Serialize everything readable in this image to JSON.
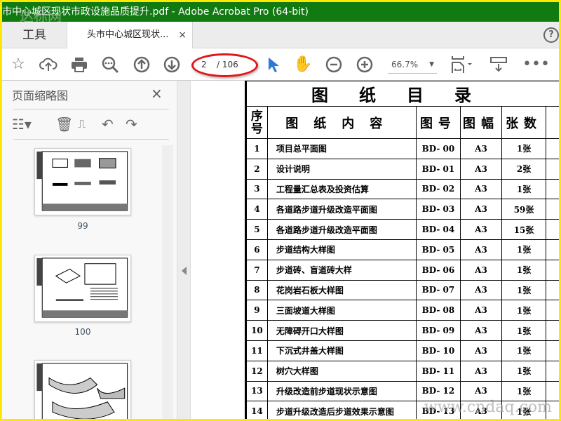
{
  "window": {
    "title": "市中心城区现状市政设施品质提升.pdf - Adobe Acrobat Pro (64-bit)",
    "watermark": "达标网"
  },
  "tabs": {
    "tools": "工具",
    "document": "头市中心城区现状...",
    "close": "×",
    "help": "?"
  },
  "toolbar": {
    "current_page": "2",
    "total_pages": "/ 106",
    "zoom": "66.7%",
    "icons": [
      "star-icon",
      "cloud-upload-icon",
      "print-icon",
      "search-zoom-icon",
      "page-up-icon",
      "page-down-icon",
      "select-arrow-icon",
      "hand-icon",
      "zoom-out-icon",
      "zoom-in-icon",
      "fit-page-icon",
      "scroll-mode-icon",
      "more-icon"
    ],
    "accent": "#e01818"
  },
  "sidebar": {
    "title": "页面缩略图",
    "close": "×",
    "thumbnails": [
      {
        "label": "99"
      },
      {
        "label": "100"
      },
      {
        "label": ""
      }
    ]
  },
  "document": {
    "title": "图纸目录",
    "headers": {
      "seq": "序号",
      "content": "图纸内容",
      "number": "图号",
      "size": "图幅",
      "count": "张数"
    },
    "rows": [
      {
        "seq": "1",
        "content": "项目总平面图",
        "number": "BD- 00",
        "size": "A3",
        "count": "1张"
      },
      {
        "seq": "2",
        "content": "设计说明",
        "number": "BD- 01",
        "size": "A3",
        "count": "2张"
      },
      {
        "seq": "3",
        "content": "工程量汇总表及投资估算",
        "number": "BD- 02",
        "size": "A3",
        "count": "1张"
      },
      {
        "seq": "4",
        "content": "各道路步道升级改造平面图",
        "number": "BD- 03",
        "size": "A3",
        "count": "59张"
      },
      {
        "seq": "5",
        "content": "各道路步道升级改造平面图",
        "number": "BD- 04",
        "size": "A3",
        "count": "15张"
      },
      {
        "seq": "6",
        "content": "步道结构大样图",
        "number": "BD- 05",
        "size": "A3",
        "count": "1张"
      },
      {
        "seq": "7",
        "content": "步道砖、盲道砖大样",
        "number": "BD- 06",
        "size": "A3",
        "count": "1张"
      },
      {
        "seq": "8",
        "content": "花岗岩石板大样图",
        "number": "BD- 07",
        "size": "A3",
        "count": "1张"
      },
      {
        "seq": "9",
        "content": "三面坡道大样图",
        "number": "BD- 08",
        "size": "A3",
        "count": "1张"
      },
      {
        "seq": "10",
        "content": "无障碍开口大样图",
        "number": "BD- 09",
        "size": "A3",
        "count": "1张"
      },
      {
        "seq": "11",
        "content": "下沉式井盖大样图",
        "number": "BD- 10",
        "size": "A3",
        "count": "1张"
      },
      {
        "seq": "12",
        "content": "树穴大样图",
        "number": "BD- 11",
        "size": "A3",
        "count": "1张"
      },
      {
        "seq": "13",
        "content": "升级改造前步道现状示意图",
        "number": "BD- 12",
        "size": "A3",
        "count": "1张"
      },
      {
        "seq": "14",
        "content": "步道升级改造后步道效果示意图",
        "number": "BD- 13",
        "size": "A3",
        "count": "1张"
      }
    ],
    "watermark": "www.cndaq.com"
  }
}
